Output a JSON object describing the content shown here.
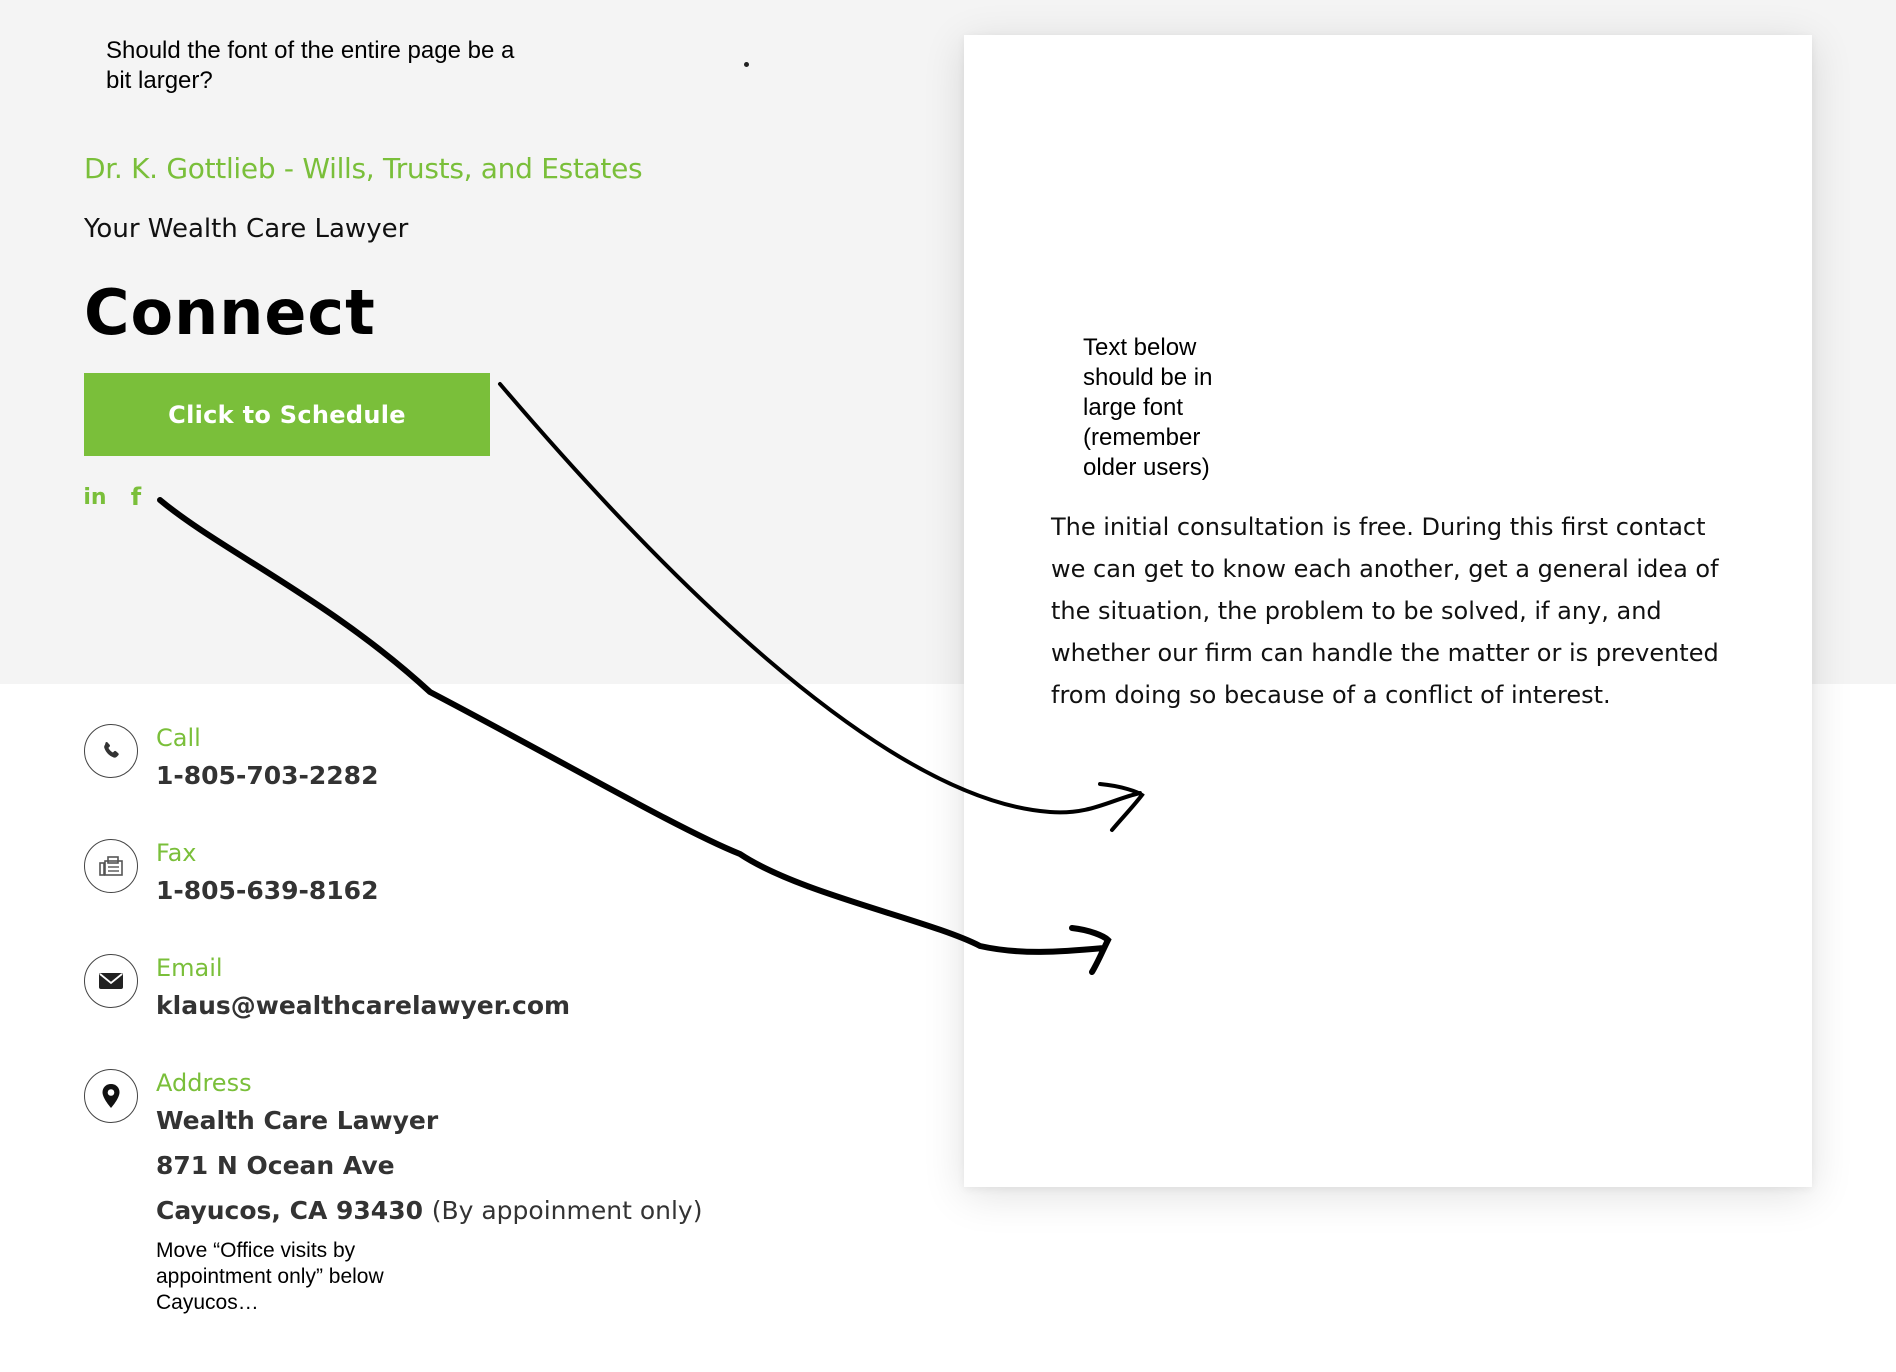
{
  "annotations": {
    "font_size_note": "Should the font of the entire page be a bit larger?",
    "large_font_note": "Text below should be in large font (remember older users)",
    "move_note": "Move “Office visits by appointment only” below Cayucos…"
  },
  "header": {
    "brand": "Dr. K. Gottlieb - Wills, Trusts, and Estates",
    "tagline": "Your Wealth Care Lawyer",
    "heading": "Connect",
    "cta_label": "Click to Schedule"
  },
  "social": {
    "linkedin_glyph": "in",
    "facebook_glyph": "f"
  },
  "contacts": {
    "call": {
      "label": "Call",
      "value": "1-805-703-2282",
      "icon": "phone-icon"
    },
    "fax": {
      "label": "Fax",
      "value": "1-805-639-8162",
      "icon": "fax-icon"
    },
    "email": {
      "label": "Email",
      "value": "klaus@wealthcarelawyer.com",
      "icon": "envelope-icon"
    },
    "address": {
      "label": "Address",
      "line1": "Wealth Care Lawyer",
      "line2": "871 N Ocean Ave",
      "line3": "Cayucos, CA 93430",
      "note": "(By appoinment only)",
      "icon": "map-pin-icon"
    }
  },
  "consultation": {
    "text": "The initial consultation is free. During this first contact we can get to know each another, get a general idea of the situation, the problem to be solved, if any, and whether our firm can handle the matter or is prevented from doing so because of a conflict of interest."
  },
  "colors": {
    "accent": "#7abf3a",
    "band": "#f4f4f4",
    "text": "#111111"
  }
}
